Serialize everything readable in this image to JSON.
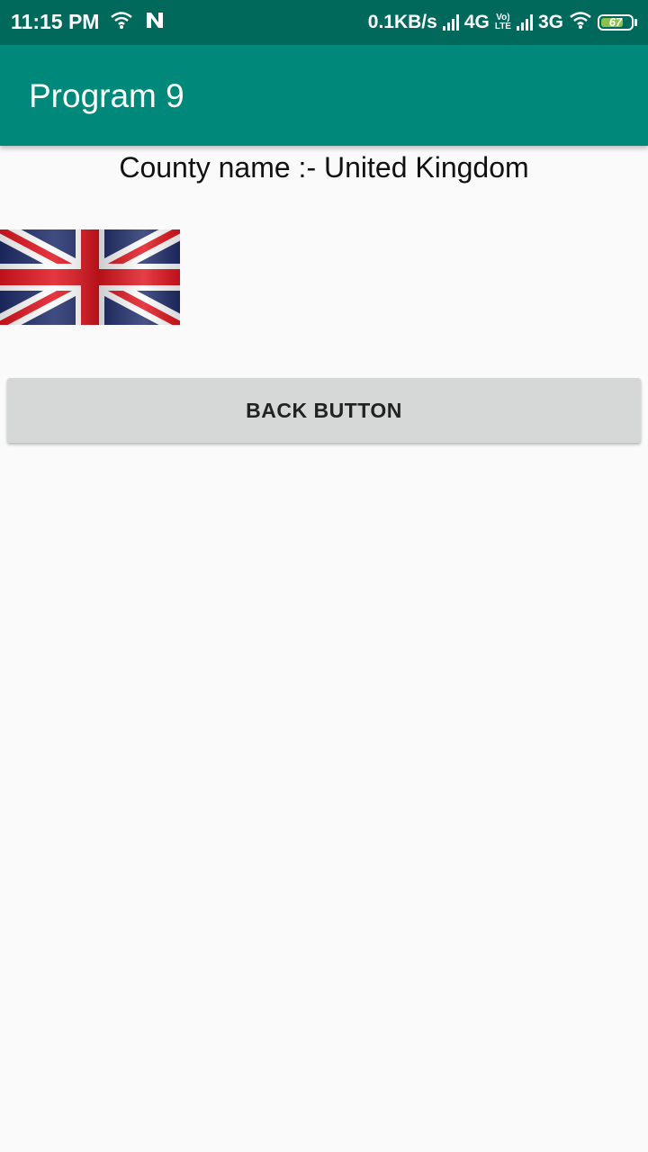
{
  "status_bar": {
    "time": "11:15 PM",
    "speed": "0.1KB/s",
    "network1": "4G",
    "volte_top": "Vo)",
    "volte_bottom": "LTE",
    "network2": "3G",
    "battery_level": "67",
    "icons": [
      "wifi-icon",
      "n-notification-icon",
      "signal-icon",
      "volte-icon",
      "signal-icon",
      "wifi-icon",
      "battery-icon"
    ]
  },
  "app_bar": {
    "title": "Program 9",
    "color": "#00897b"
  },
  "content": {
    "country_label": "County name :- United Kingdom",
    "flag": "union-jack-flag",
    "back_button_label": "BACK BUTTON"
  },
  "colors": {
    "status_bar": "#00695c",
    "app_bar": "#00897b",
    "background": "#fafafa",
    "button": "#d6d7d7"
  }
}
